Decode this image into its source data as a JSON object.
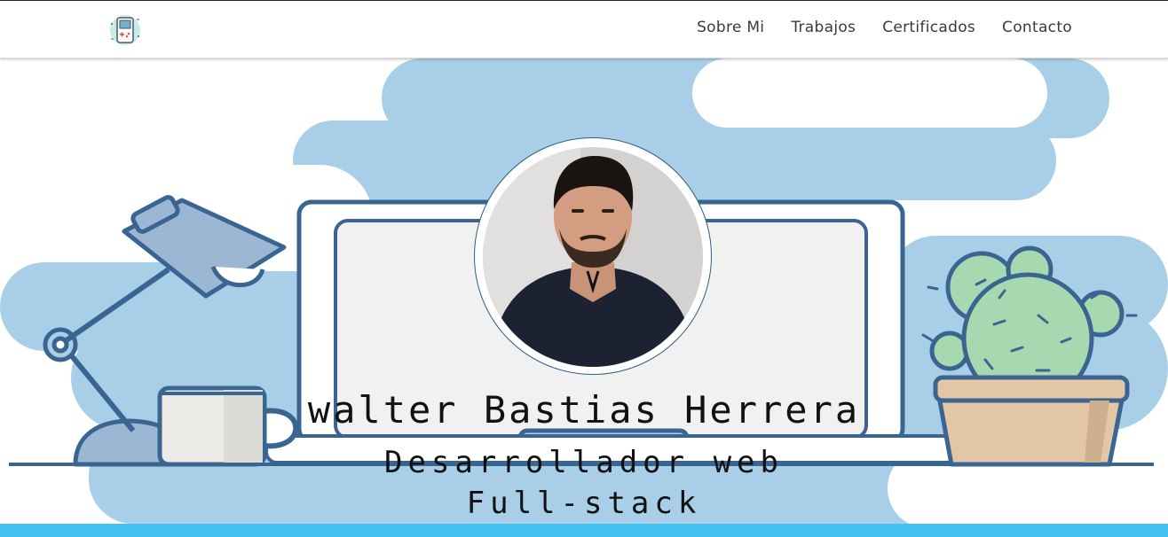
{
  "navbar": {
    "logo_icon": "gameboy-icon",
    "links": [
      {
        "label": "Sobre Mi"
      },
      {
        "label": "Trabajos"
      },
      {
        "label": "Certificados"
      },
      {
        "label": "Contacto"
      }
    ]
  },
  "hero": {
    "name": "walter Bastias Herrera",
    "role_line1": "Desarrollador web",
    "role_line2": "Full-stack",
    "illustration_icons": [
      "desk-lamp-icon",
      "laptop-icon",
      "coffee-mug-icon",
      "cactus-icon",
      "profile-photo"
    ]
  },
  "colors": {
    "cloud_blue": "#a9cfe8",
    "outline_blue": "#3a6591",
    "cactus_green": "#a8d8b0",
    "pot_tan": "#e3c6a5",
    "accent_bar": "#45c0ef"
  }
}
